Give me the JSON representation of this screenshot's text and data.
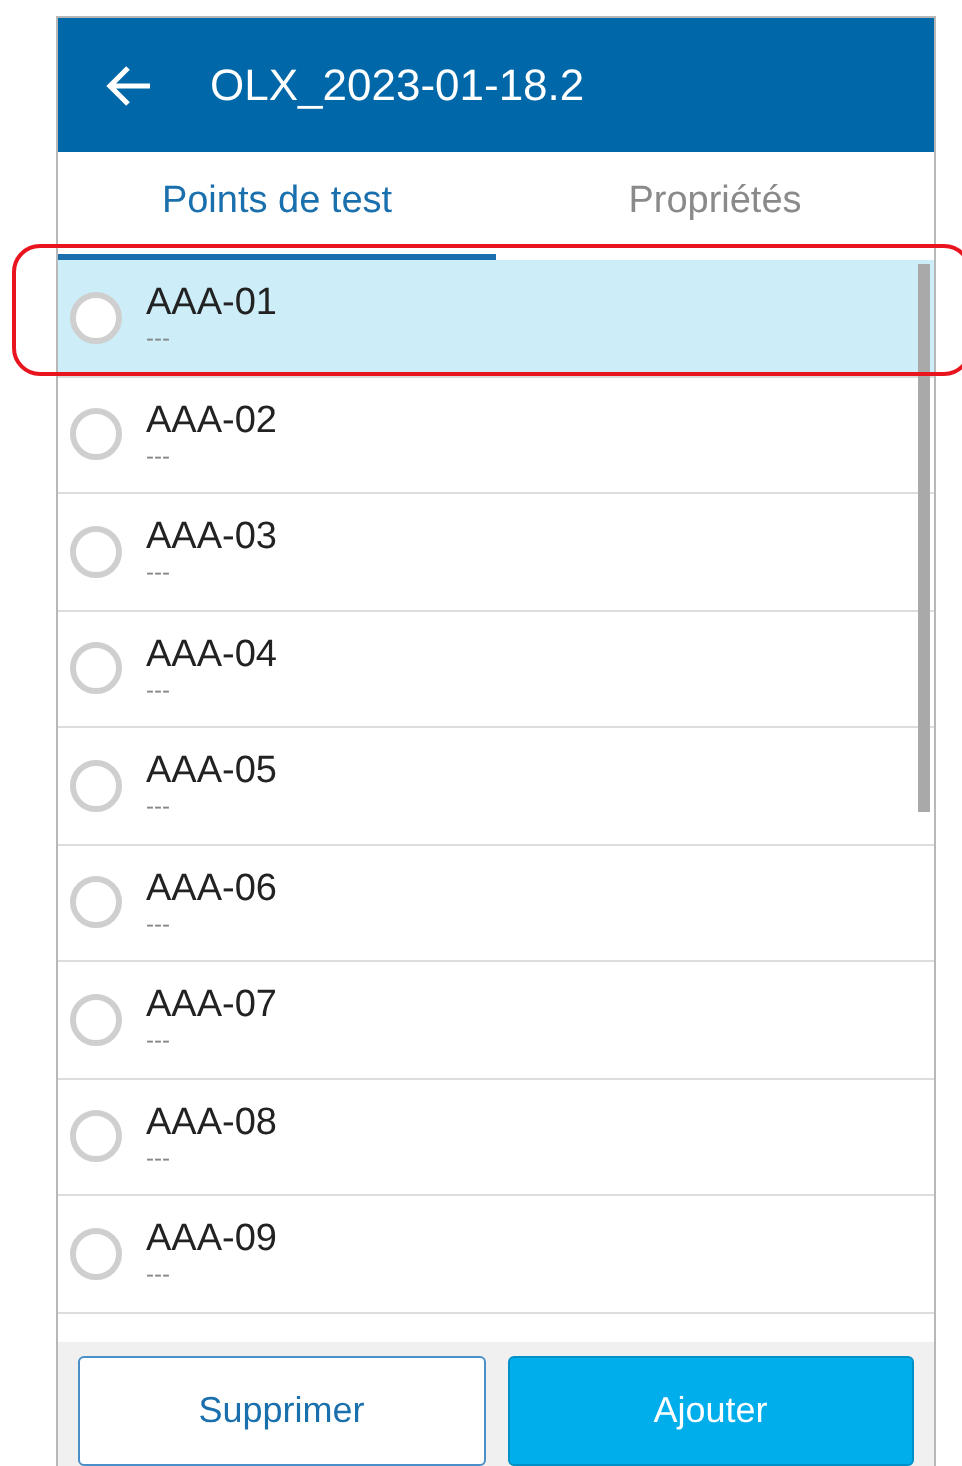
{
  "header": {
    "title": "OLX_2023-01-18.2"
  },
  "tabs": [
    {
      "label": "Points de test",
      "selected": true
    },
    {
      "label": "Propriétés",
      "selected": false
    }
  ],
  "points": [
    {
      "name": "AAA-01",
      "detail": "---",
      "selected": true
    },
    {
      "name": "AAA-02",
      "detail": "---",
      "selected": false
    },
    {
      "name": "AAA-03",
      "detail": "---",
      "selected": false
    },
    {
      "name": "AAA-04",
      "detail": "---",
      "selected": false
    },
    {
      "name": "AAA-05",
      "detail": "---",
      "selected": false
    },
    {
      "name": "AAA-06",
      "detail": "---",
      "selected": false
    },
    {
      "name": "AAA-07",
      "detail": "---",
      "selected": false
    },
    {
      "name": "AAA-08",
      "detail": "---",
      "selected": false
    },
    {
      "name": "AAA-09",
      "detail": "---",
      "selected": false
    }
  ],
  "buttons": [
    {
      "label": "Supprimer",
      "kind": "outline"
    },
    {
      "label": "Ajouter",
      "kind": "primary"
    }
  ]
}
